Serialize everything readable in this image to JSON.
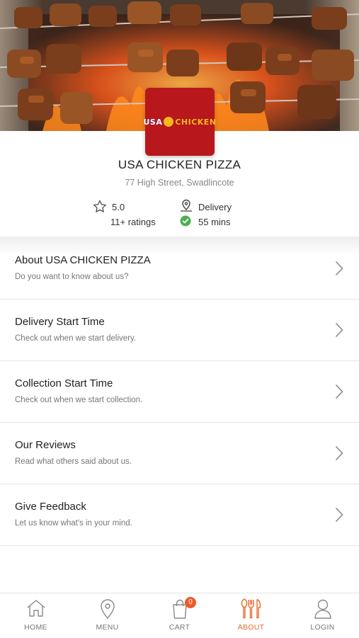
{
  "store": {
    "name": "USA CHICKEN PIZZA",
    "address": "77 High Street, Swadlincote",
    "logo_text_left": "USA",
    "logo_text_right": "CHICKEN",
    "brand_color": "#b8171c"
  },
  "stats": {
    "rating": "5.0",
    "ratings_count": "11+ ratings",
    "delivery_label": "Delivery",
    "delivery_time": "55 mins",
    "rating_icon": "star-icon",
    "delivery_icon": "location-pin-icon",
    "time_icon": "check-circle-icon",
    "check_color": "#4caf50"
  },
  "menu": {
    "items": [
      {
        "title": "About USA CHICKEN PIZZA",
        "subtitle": "Do you want to know about us?"
      },
      {
        "title": "Delivery Start Time",
        "subtitle": "Check out when we start delivery."
      },
      {
        "title": "Collection Start Time",
        "subtitle": "Check out when we start collection."
      },
      {
        "title": "Our Reviews",
        "subtitle": "Read what others said about us."
      },
      {
        "title": "Give Feedback",
        "subtitle": "Let us know what's in your mind."
      }
    ]
  },
  "tabbar": {
    "accent_color": "#e8692c",
    "tabs": [
      {
        "label": "HOME",
        "icon": "home-icon"
      },
      {
        "label": "MENU",
        "icon": "location-pin-icon"
      },
      {
        "label": "CART",
        "icon": "shopping-bag-icon",
        "badge": "0"
      },
      {
        "label": "ABOUT",
        "icon": "fork-knife-icon",
        "active": true
      },
      {
        "label": "LOGIN",
        "icon": "user-icon"
      }
    ]
  }
}
